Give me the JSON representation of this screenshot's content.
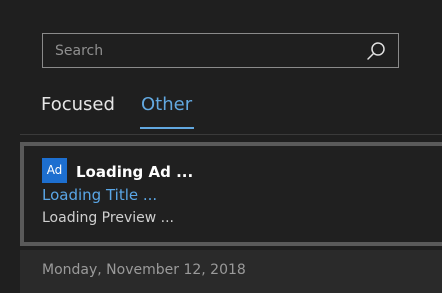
{
  "search": {
    "placeholder": "Search",
    "value": ""
  },
  "tabs": [
    {
      "label": "Focused",
      "selected": false
    },
    {
      "label": "Other",
      "selected": true
    }
  ],
  "ad": {
    "badge": "Ad",
    "sender": "Loading Ad ...",
    "title": "Loading Title ...",
    "preview": "Loading Preview ..."
  },
  "date_header": "Monday, November 12, 2018",
  "colors": {
    "background": "#1f1f1f",
    "accent": "#62a8e0",
    "ad_badge": "#1d6fd0"
  },
  "icons": [
    "search-icon"
  ]
}
